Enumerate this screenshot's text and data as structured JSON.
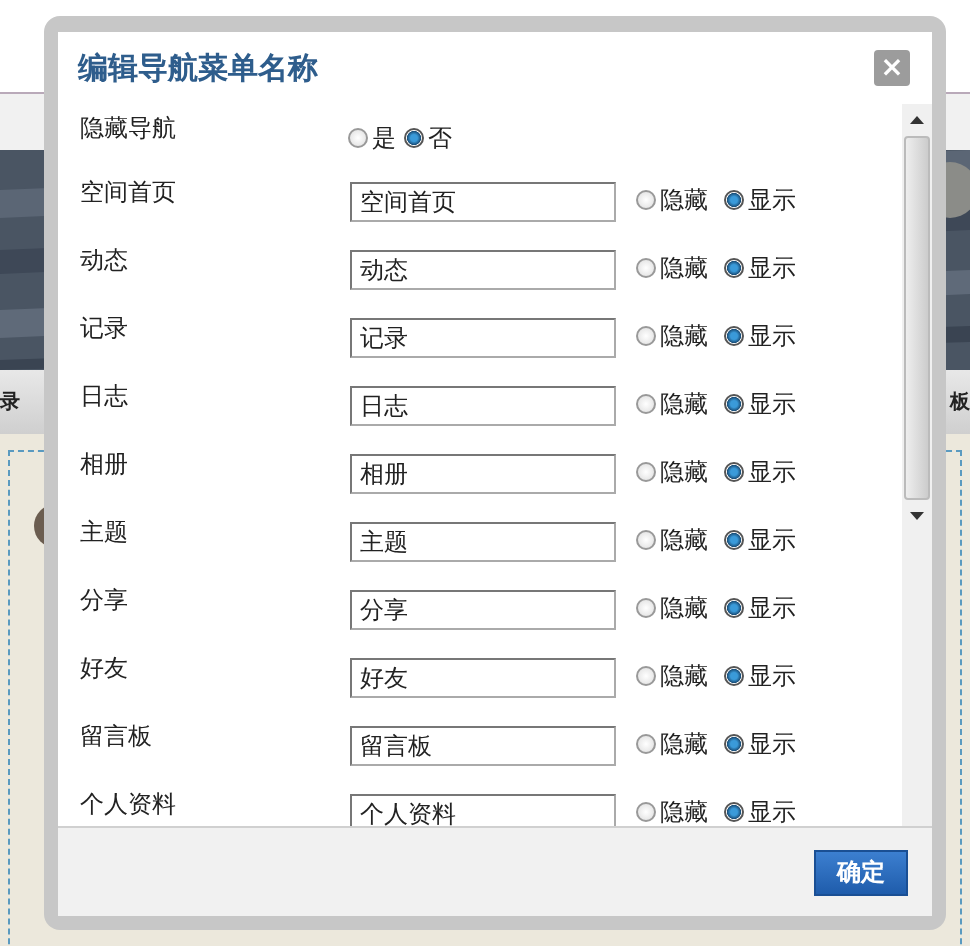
{
  "background": {
    "tab_left": "录",
    "tab_right": "板"
  },
  "dialog": {
    "title": "编辑导航菜单名称",
    "close": "×",
    "hide_nav": {
      "label": "隐藏导航",
      "options": [
        {
          "label": "是",
          "selected": false
        },
        {
          "label": "否",
          "selected": true
        }
      ]
    },
    "items": [
      {
        "label": "空间首页",
        "value": "空间首页",
        "options": [
          {
            "label": "隐藏",
            "selected": false
          },
          {
            "label": "显示",
            "selected": true
          }
        ]
      },
      {
        "label": "动态",
        "value": "动态",
        "options": [
          {
            "label": "隐藏",
            "selected": false
          },
          {
            "label": "显示",
            "selected": true
          }
        ]
      },
      {
        "label": "记录",
        "value": "记录",
        "options": [
          {
            "label": "隐藏",
            "selected": false
          },
          {
            "label": "显示",
            "selected": true
          }
        ]
      },
      {
        "label": "日志",
        "value": "日志",
        "options": [
          {
            "label": "隐藏",
            "selected": false
          },
          {
            "label": "显示",
            "selected": true
          }
        ]
      },
      {
        "label": "相册",
        "value": "相册",
        "options": [
          {
            "label": "隐藏",
            "selected": false
          },
          {
            "label": "显示",
            "selected": true
          }
        ]
      },
      {
        "label": "主题",
        "value": "主题",
        "options": [
          {
            "label": "隐藏",
            "selected": false
          },
          {
            "label": "显示",
            "selected": true
          }
        ]
      },
      {
        "label": "分享",
        "value": "分享",
        "options": [
          {
            "label": "隐藏",
            "selected": false
          },
          {
            "label": "显示",
            "selected": true
          }
        ]
      },
      {
        "label": "好友",
        "value": "好友",
        "options": [
          {
            "label": "隐藏",
            "selected": false
          },
          {
            "label": "显示",
            "selected": true
          }
        ]
      },
      {
        "label": "留言板",
        "value": "留言板",
        "options": [
          {
            "label": "隐藏",
            "selected": false
          },
          {
            "label": "显示",
            "selected": true
          }
        ]
      },
      {
        "label": "个人资料",
        "value": "个人资料",
        "options": [
          {
            "label": "隐藏",
            "selected": false
          },
          {
            "label": "显示",
            "selected": true
          }
        ]
      }
    ],
    "confirm": "确定"
  }
}
